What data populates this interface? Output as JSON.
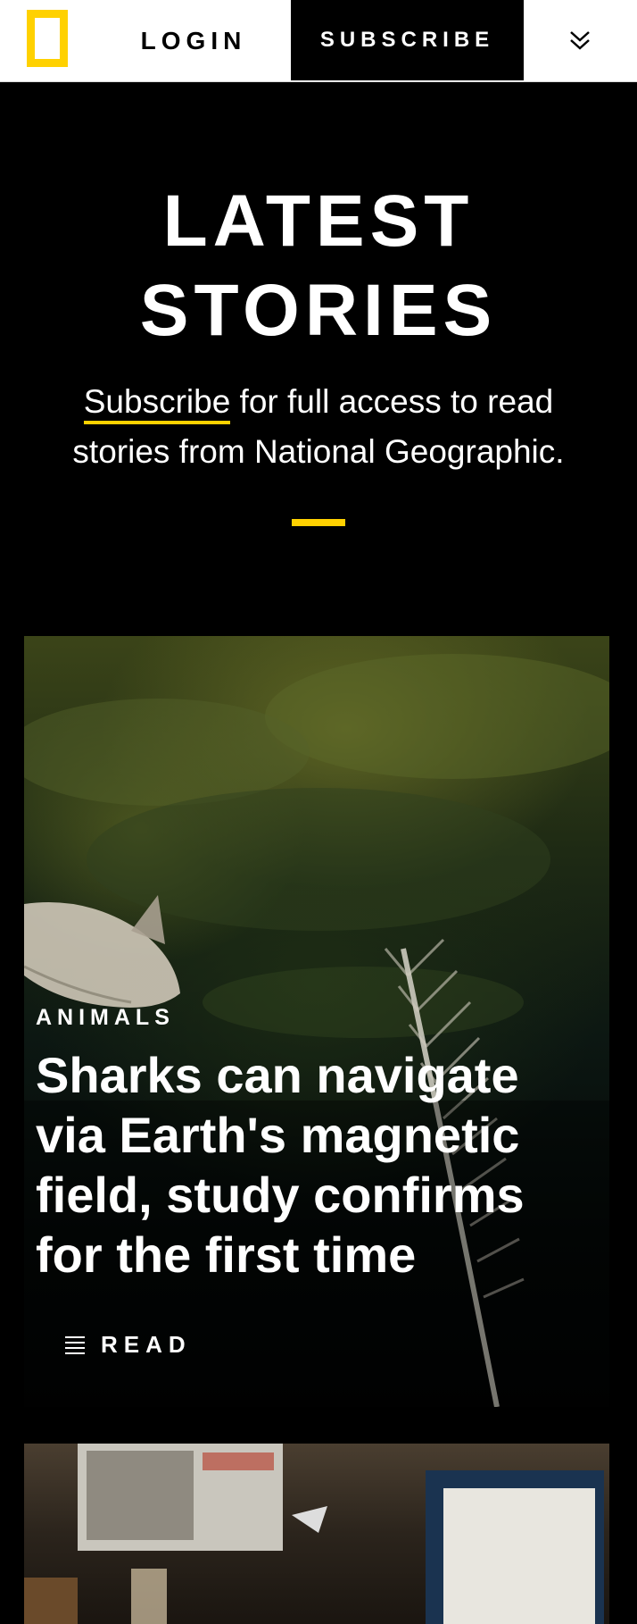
{
  "header": {
    "logo_icon": "yellow-border-logo",
    "login_label": "LOGIN",
    "subscribe_label": "SUBSCRIBE",
    "menu_icon": "double-chevron-down-icon"
  },
  "hero": {
    "title_line1": "LATEST",
    "title_line2": "STORIES",
    "subscribe_link": "Subscribe",
    "subtitle_rest": " for full access to read stories from National Geographic."
  },
  "stories": [
    {
      "category": "ANIMALS",
      "title": "Sharks can navigate via Earth's magnetic field, study confirms for the first time",
      "read_label": "READ"
    }
  ],
  "colors": {
    "accent": "#ffd100",
    "background": "#000000",
    "header_bg": "#ffffff"
  }
}
